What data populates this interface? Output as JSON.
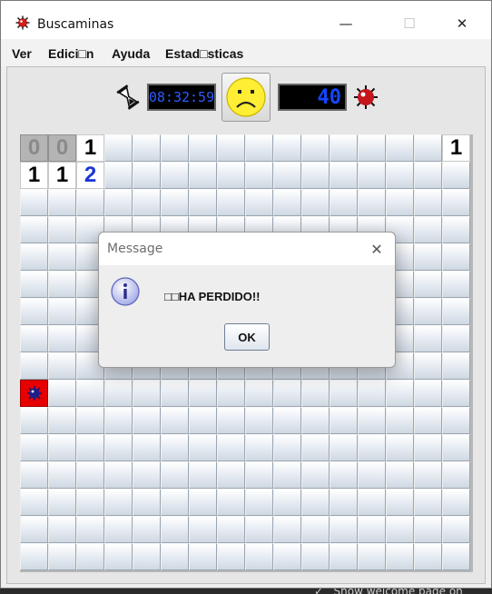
{
  "window": {
    "title": "Buscaminas",
    "controls": {
      "minimize": "—",
      "maximize": "☐",
      "close": "✕"
    }
  },
  "menu": [
    {
      "label": "Ver"
    },
    {
      "label": "Edici□n"
    },
    {
      "label": "Ayuda"
    },
    {
      "label": "Estad□sticas"
    }
  ],
  "status": {
    "timer": "08:32:59",
    "mines_left": "40",
    "face": "sad-face-icon"
  },
  "board": {
    "rows": 16,
    "cols": 16,
    "revealed": [
      {
        "row": 0,
        "col": 0,
        "label": "0",
        "state": "open"
      },
      {
        "row": 0,
        "col": 1,
        "label": "0",
        "state": "open"
      },
      {
        "row": 0,
        "col": 2,
        "label": "1",
        "state": "white"
      },
      {
        "row": 0,
        "col": 15,
        "label": "1",
        "state": "white"
      },
      {
        "row": 1,
        "col": 0,
        "label": "1",
        "state": "white"
      },
      {
        "row": 1,
        "col": 1,
        "label": "1",
        "state": "white"
      },
      {
        "row": 1,
        "col": 2,
        "label": "2",
        "state": "white"
      },
      {
        "row": 9,
        "col": 0,
        "label": "",
        "state": "mine"
      }
    ]
  },
  "dialog": {
    "title": "Message",
    "message": "□□HA PERDIDO!!",
    "ok_label": "OK",
    "close": "✕"
  },
  "colors": {
    "lcd_digits": "#1446ff",
    "mine_cell": "#e60000",
    "number_two": "#1a35d6"
  }
}
